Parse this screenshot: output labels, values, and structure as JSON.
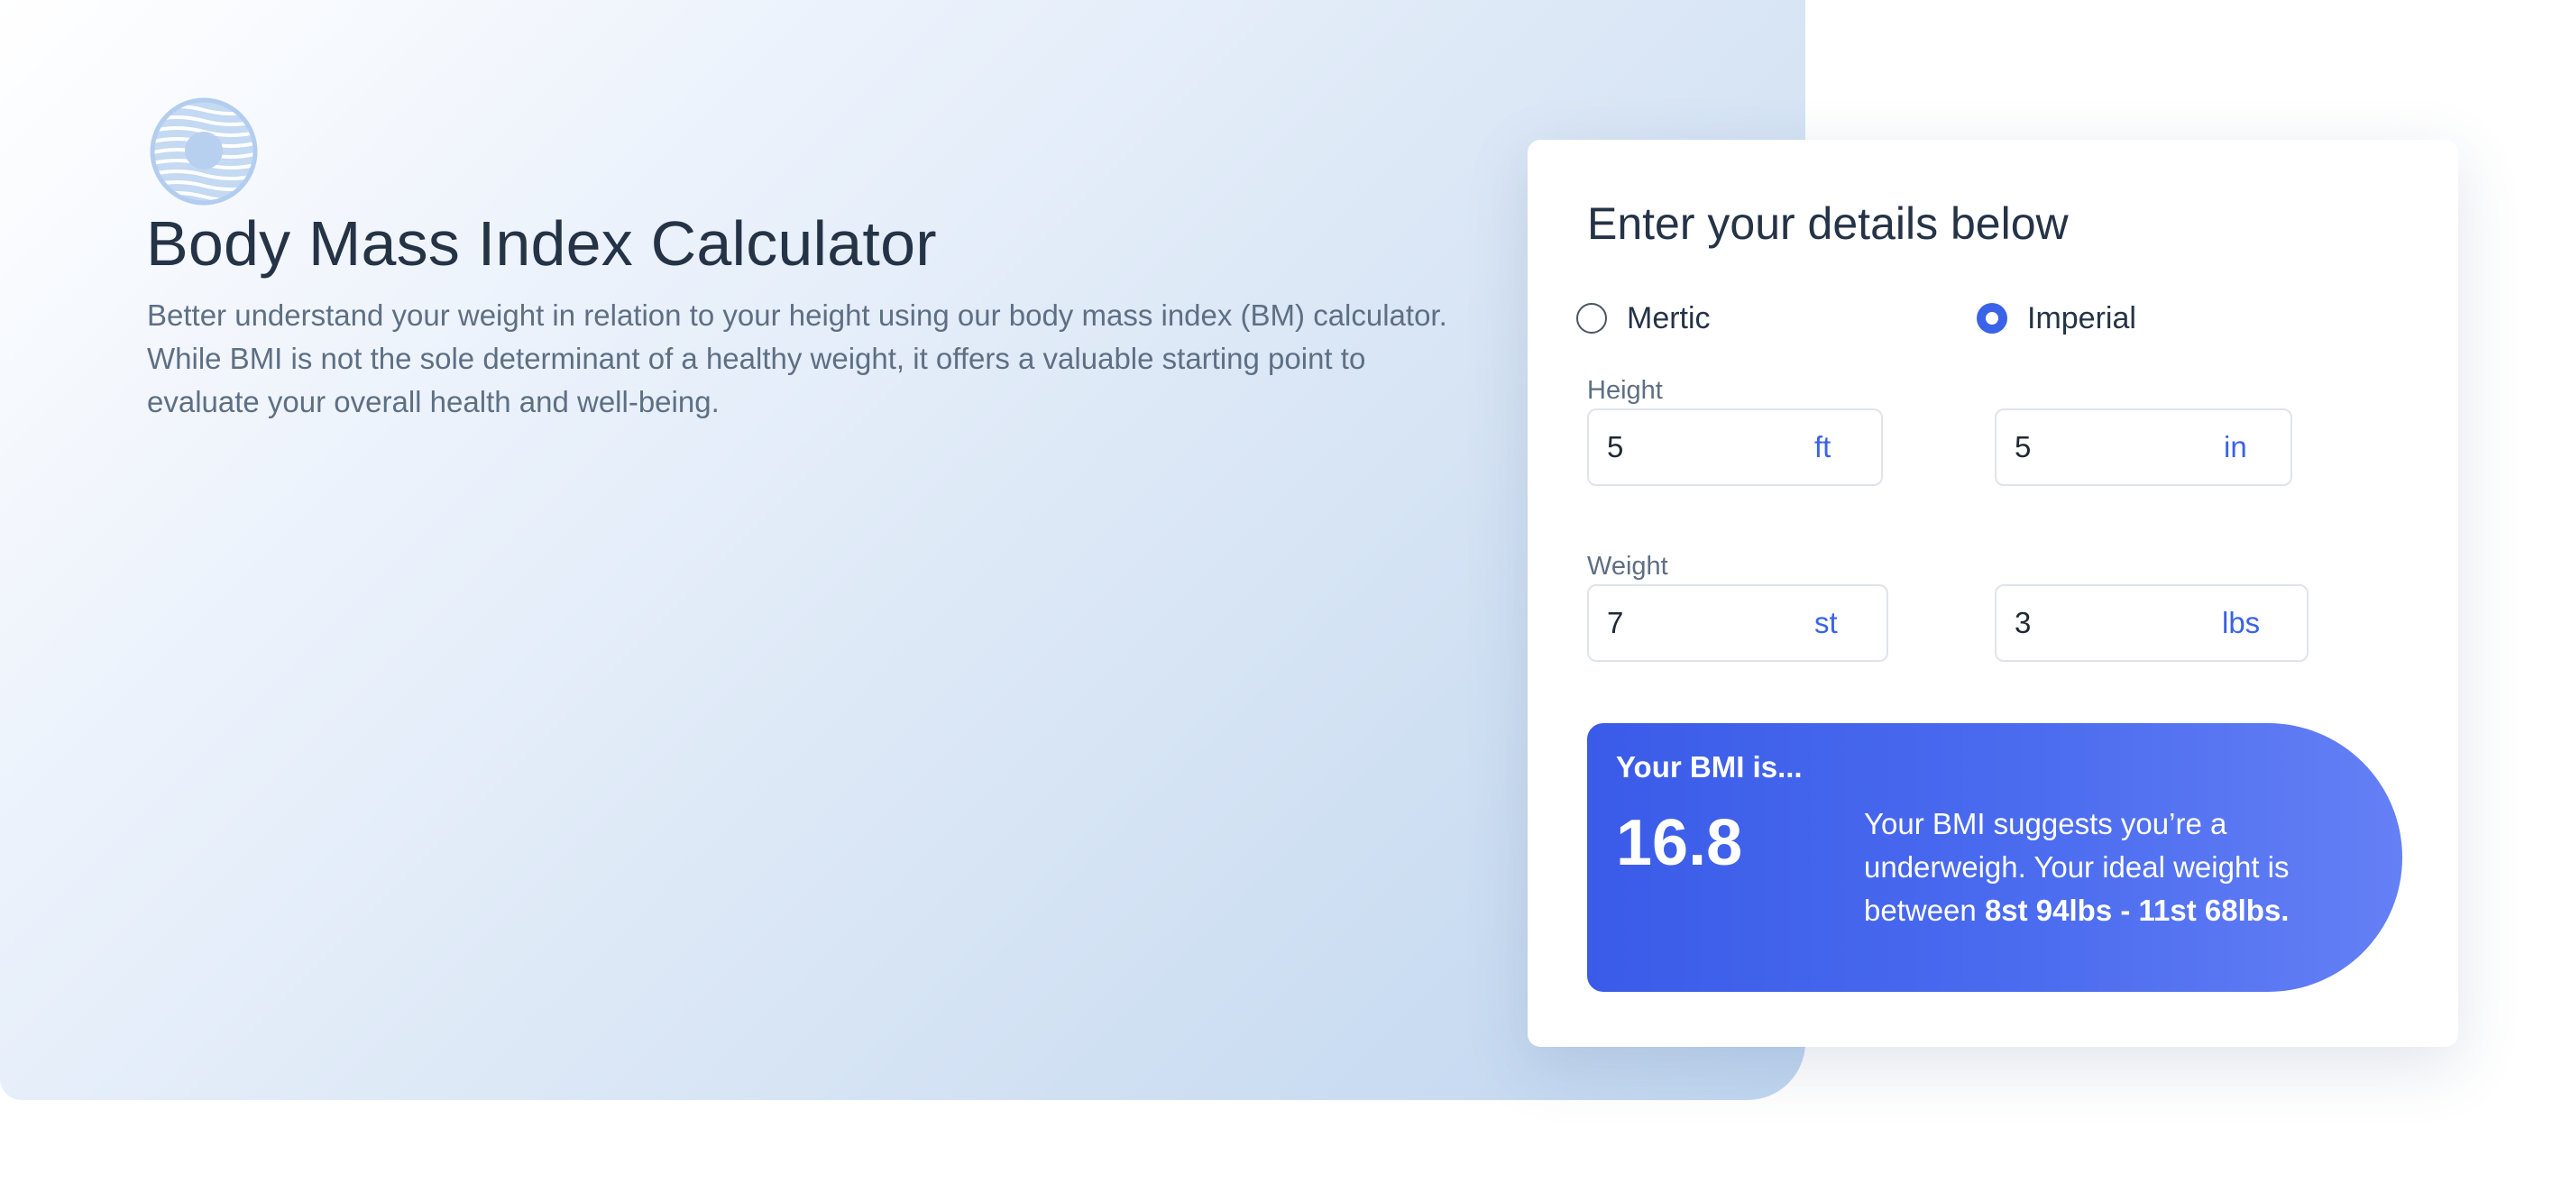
{
  "header": {
    "logo_icon": "striped-circle-logo-icon",
    "title": "Body Mass Index Calculator",
    "intro": "Better understand your weight in relation to your height using our body mass index (BM) calculator. While BMI is not the sole determinant of a healthy weight, it offers a valuable starting point to evaluate your overall health and well-being."
  },
  "form": {
    "title": "Enter your details below",
    "unit_system": {
      "options": [
        "Mertic",
        "Imperial"
      ],
      "selected": "Imperial"
    },
    "height": {
      "label": "Height",
      "feet": {
        "value": "5",
        "unit": "ft"
      },
      "inches": {
        "value": "5",
        "unit": "in"
      }
    },
    "weight": {
      "label": "Weight",
      "stone": {
        "value": "7",
        "unit": "st"
      },
      "pounds": {
        "value": "3",
        "unit": "lbs"
      }
    }
  },
  "result": {
    "heading": "Your BMI is...",
    "value": "16.8",
    "text_prefix": "Your BMI suggests you’re a underweigh. Your ideal weight is between ",
    "ideal_range": "8st 94lbs - 11st 68lbs."
  },
  "colors": {
    "accent": "#3a63e8",
    "result_gradient_start": "#3a5be8",
    "result_gradient_end": "#6580f5",
    "hero_gradient_end": "#c0d6f0",
    "title_text": "#253347",
    "body_text": "#5e6f84"
  }
}
